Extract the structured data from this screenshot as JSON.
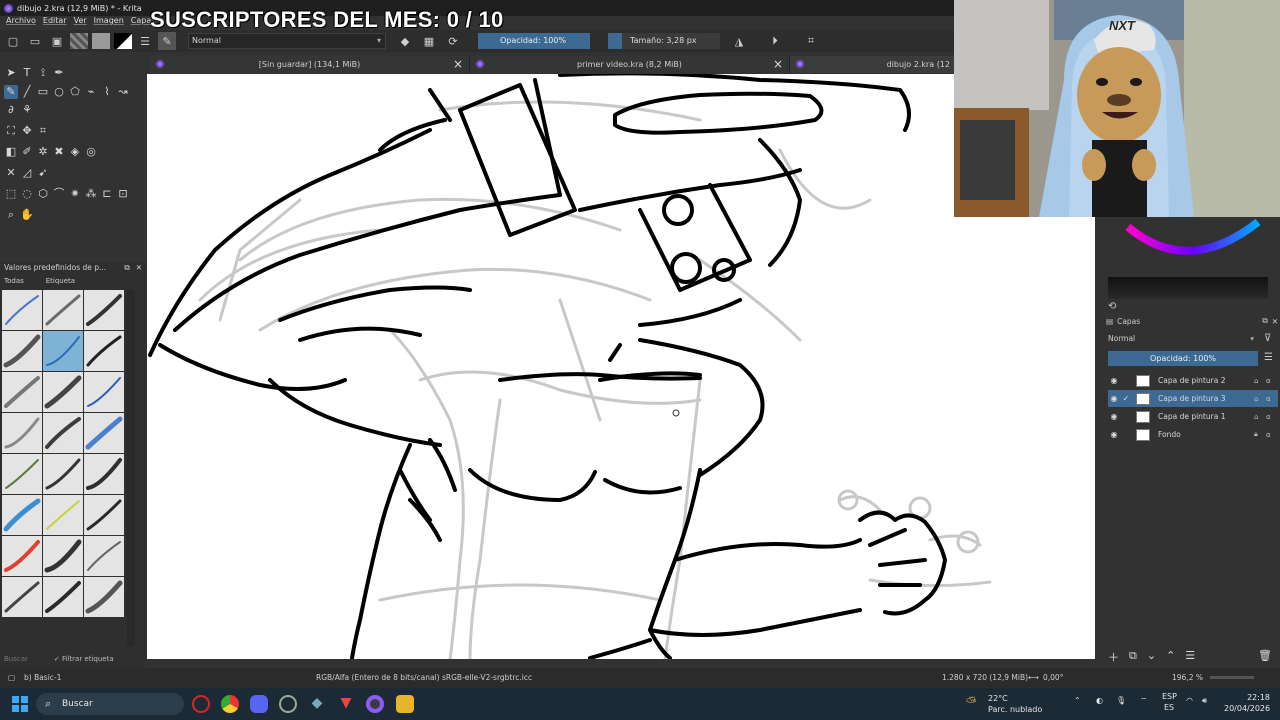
{
  "window": {
    "title": "dibujo 2.kra (12,9 MiB) * - Krita"
  },
  "menu": [
    "Archivo",
    "Editar",
    "Ver",
    "Imagen",
    "Capa"
  ],
  "overlay": {
    "banner": "SUSCRIPTORES DEL MES: 0 / 10"
  },
  "toolbar": {
    "blend_mode": "Normal",
    "opacity": "Opacidad: 100%",
    "size": "Tamaño: 3,28 px"
  },
  "tabs": [
    {
      "label": "[Sin guardar]  (134,1 MiB)"
    },
    {
      "label": "primer video.kra (8,2 MiB)"
    },
    {
      "label": "dibujo 2.kra (12"
    }
  ],
  "presets": {
    "title": "Valores predefinidos de p...",
    "filter_all": "Todas",
    "filter_tag": "Etiqueta",
    "search_placeholder": "Buscar",
    "filter_tag_check": "Filtrar etiqueta"
  },
  "layers": {
    "title": "Capas",
    "blend_mode": "Normal",
    "opacity": "Opacidad:  100%",
    "items": [
      {
        "name": "Capa de pintura 2",
        "selected": false,
        "locked": false
      },
      {
        "name": "Capa de pintura 3",
        "selected": true,
        "locked": false
      },
      {
        "name": "Capa de pintura 1",
        "selected": false,
        "locked": false
      },
      {
        "name": "Fondo",
        "selected": false,
        "locked": true
      }
    ]
  },
  "status": {
    "brush": "b) Basic-1",
    "color_space": "RGB/Alfa (Entero de 8 bits/canal)  sRGB-elle-V2-srgbtrc.icc",
    "image_size": "1.280 x 720 (12,9 MiB)",
    "rotation": "0,00°",
    "zoom": "196,2 %"
  },
  "taskbar": {
    "search": "Buscar",
    "weather_temp": "22°C",
    "weather_cond": "Parc. nublado",
    "lang_top": "ESP",
    "lang_bottom": "ES",
    "time": "22:18",
    "date": "20/04/2026"
  },
  "webcam": {
    "cap_text": "NXT"
  },
  "colors": {
    "accent": "#3d6a92",
    "panel": "#323232",
    "canvas": "#ffffff"
  }
}
